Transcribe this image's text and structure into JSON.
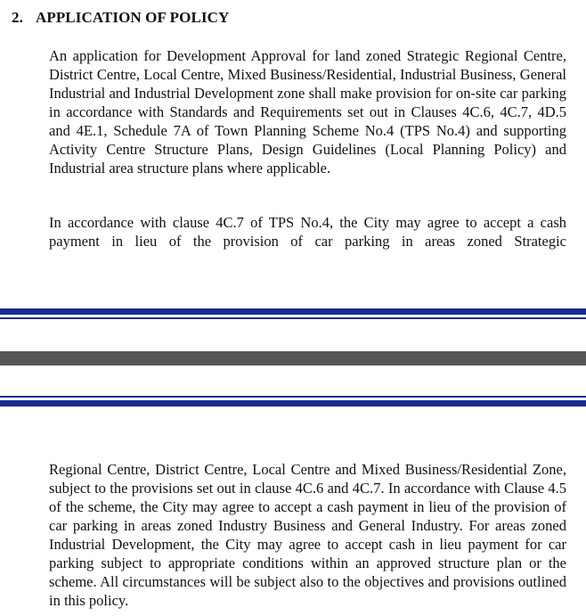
{
  "section": {
    "number": "2.",
    "title": "APPLICATION OF POLICY"
  },
  "paragraphs": [
    "An application for Development Approval for land zoned Strategic Regional Centre, District Centre, Local Centre, Mixed Business/Residential, Industrial Business, General Industrial and Industrial Development zone shall make provision for on-site car parking in accordance with Standards and Requirements set out in Clauses 4C.6, 4C.7, 4D.5 and 4E.1, Schedule 7A of Town Planning Scheme No.4 (TPS No.4) and supporting Activity Centre Structure Plans, Design Guidelines (Local Planning Policy) and Industrial area structure plans where applicable.",
    "In accordance with clause 4C.7 of TPS No.4, the City may agree to accept a cash payment in lieu of the provision of car parking in areas zoned Strategic",
    "Regional Centre, District Centre, Local Centre and Mixed Business/Residential Zone, subject to the provisions set out in clause 4C.6 and 4C.7. In accordance with Clause 4.5 of the scheme, the City may agree to accept a cash payment in lieu of the provision of car parking in areas zoned Industry Business and General Industry. For areas zoned Industrial Development, the City may agree to accept cash in lieu payment for car parking subject to appropriate conditions within an approved structure plan or the scheme. All circumstances will be subject also to the objectives and provisions outlined in this policy."
  ]
}
